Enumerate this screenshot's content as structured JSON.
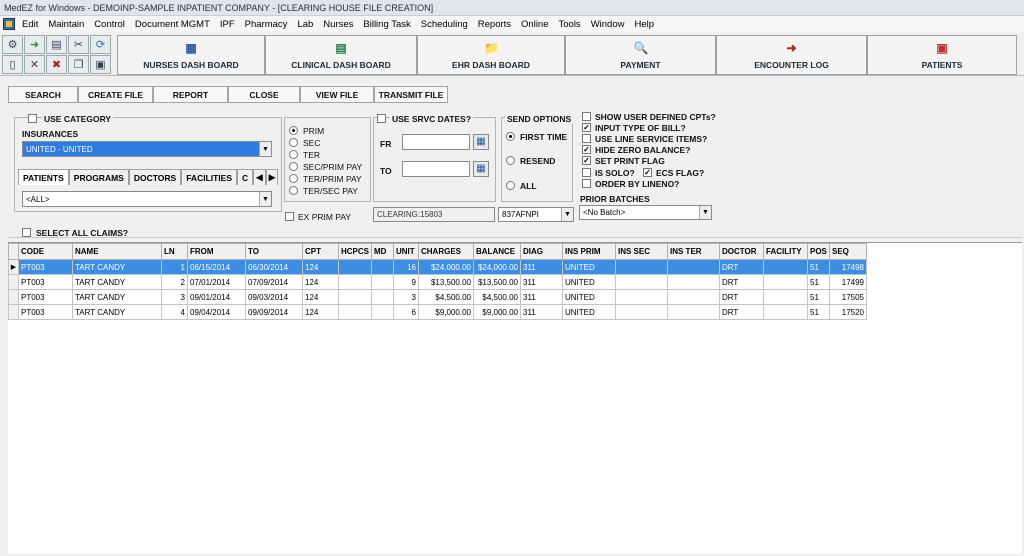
{
  "window": {
    "title": "MedEZ for Windows - DEMOINP-SAMPLE INPATIENT COMPANY - [CLEARING HOUSE FILE CREATION]"
  },
  "menu": [
    "Edit",
    "Maintain",
    "Control",
    "Document MGMT",
    "IPF",
    "Pharmacy",
    "Lab",
    "Nurses",
    "Billing Task",
    "Scheduling",
    "Reports",
    "Online",
    "Tools",
    "Window",
    "Help"
  ],
  "dashboards": [
    {
      "label": "NURSES DASH BOARD",
      "icon": "nurses-dashboard-icon"
    },
    {
      "label": "CLINICAL DASH BOARD",
      "icon": "clinical-dashboard-icon"
    },
    {
      "label": "EHR DASH BOARD",
      "icon": "ehr-dashboard-icon"
    },
    {
      "label": "PAYMENT",
      "icon": "payment-icon"
    },
    {
      "label": "ENCOUNTER LOG",
      "icon": "encounter-log-icon"
    },
    {
      "label": "PATIENTS",
      "icon": "patients-icon"
    }
  ],
  "actions": [
    "SEARCH",
    "CREATE FILE",
    "REPORT",
    "CLOSE",
    "VIEW FILE",
    "TRANSMIT FILE"
  ],
  "filters": {
    "use_category": "USE CATEGORY",
    "insurances_label": "INSURANCES",
    "insurance_value": "UNITED - UNITED",
    "tabs": [
      "PATIENTS",
      "PROGRAMS",
      "DOCTORS",
      "FACILITIES",
      "C"
    ],
    "all_value": "<ALL>",
    "payer_options": [
      "PRIM",
      "SEC",
      "TER",
      "SEC/PRIM PAY",
      "TER/PRIM PAY",
      "TER/SEC PAY"
    ],
    "payer_selected": "PRIM",
    "ex_prim_pay": "EX PRIM PAY",
    "use_srvc_dates": "USE SRVC DATES?",
    "fr_label": "FR",
    "to_label": "TO",
    "clearing_value": "CLEARING:15803",
    "format_value": "837AFNPI",
    "send_options_label": "SEND OPTIONS",
    "send_options": [
      "FIRST TIME",
      "RESEND",
      "ALL"
    ],
    "send_selected": "FIRST TIME",
    "checks": [
      {
        "label": "SHOW USER DEFINED CPTs?",
        "checked": false
      },
      {
        "label": "INPUT TYPE OF BILL?",
        "checked": true
      },
      {
        "label": "USE LINE SERVICE ITEMS?",
        "checked": false
      },
      {
        "label": "HIDE ZERO BALANCE?",
        "checked": true
      },
      {
        "label": "SET PRINT FLAG",
        "checked": true
      },
      {
        "label": "IS SOLO?",
        "checked": false
      },
      {
        "label": "ECS FLAG?",
        "checked": true
      },
      {
        "label": "ORDER BY LINENO?",
        "checked": false
      }
    ],
    "prior_batches_label": "PRIOR BATCHES",
    "prior_batches_value": "<No Batch>",
    "select_all": "SELECT ALL CLAIMS?"
  },
  "table": {
    "columns": [
      "CODE",
      "NAME",
      "LN",
      "FROM",
      "TO",
      "CPT",
      "HCPCS",
      "MD",
      "UNIT",
      "CHARGES",
      "BALANCE",
      "DIAG",
      "INS PRIM",
      "INS SEC",
      "INS TER",
      "DOCTOR",
      "FACILITY",
      "POS",
      "SEQ"
    ],
    "rows": [
      [
        "PT003",
        "TART CANDY",
        "1",
        "06/15/2014",
        "06/30/2014",
        "124",
        "",
        "",
        "16",
        "$24,000.00",
        "$24,000.00",
        "311",
        "UNITED",
        "",
        "",
        "DRT",
        "",
        "51",
        "17498"
      ],
      [
        "PT003",
        "TART CANDY",
        "2",
        "07/01/2014",
        "07/09/2014",
        "124",
        "",
        "",
        "9",
        "$13,500.00",
        "$13,500.00",
        "311",
        "UNITED",
        "",
        "",
        "DRT",
        "",
        "51",
        "17499"
      ],
      [
        "PT003",
        "TART CANDY",
        "3",
        "09/01/2014",
        "09/03/2014",
        "124",
        "",
        "",
        "3",
        "$4,500.00",
        "$4,500.00",
        "311",
        "UNITED",
        "",
        "",
        "DRT",
        "",
        "51",
        "17505"
      ],
      [
        "PT003",
        "TART CANDY",
        "4",
        "09/04/2014",
        "09/09/2014",
        "124",
        "",
        "",
        "6",
        "$9,000.00",
        "$9,000.00",
        "311",
        "UNITED",
        "",
        "",
        "DRT",
        "",
        "51",
        "17520"
      ]
    ],
    "selected_row": 0
  }
}
